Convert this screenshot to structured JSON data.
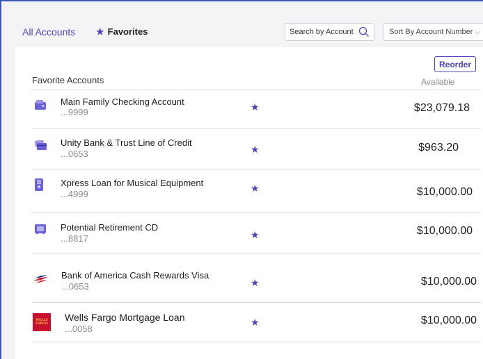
{
  "tabs": {
    "all_accounts": "All Accounts",
    "favorites": "Favorites"
  },
  "search": {
    "placeholder": "Search by Account"
  },
  "sort": {
    "label": "Sort By Account Number"
  },
  "panel": {
    "reorder": "Reorder",
    "title": "Favorite Accounts",
    "available_header": "Available"
  },
  "accounts": [
    {
      "name": "Main Family Checking Account",
      "number": "...9999",
      "amount": "$23,079.18",
      "icon": "wallet-icon"
    },
    {
      "name": "Unity Bank & Trust Line of Credit",
      "number": "...0653",
      "amount": "$963.20",
      "icon": "credit-cards-icon"
    },
    {
      "name": "Xpress Loan for Musical Equipment",
      "number": "...4999",
      "amount": "$10,000.00",
      "icon": "loan-document-icon"
    },
    {
      "name": "Potential  Retirement CD",
      "number": "...8817",
      "amount": "$10,000.00",
      "icon": "safe-vault-icon"
    },
    {
      "name": "Bank of America Cash Rewards Visa",
      "number": "...0653",
      "amount": "$10,000.00",
      "icon": "bank-of-america-logo"
    },
    {
      "name": "Wells Fargo Mortgage Loan",
      "number": "...0058",
      "amount": "$10,000.00",
      "icon": "wells-fargo-logo",
      "logo_text": "WELLS FARGO"
    }
  ],
  "colors": {
    "accent": "#4a45c4",
    "frame_border": "#3a57b5",
    "divider": "#d7d7dc",
    "wells_fargo_red": "#c8102e"
  }
}
